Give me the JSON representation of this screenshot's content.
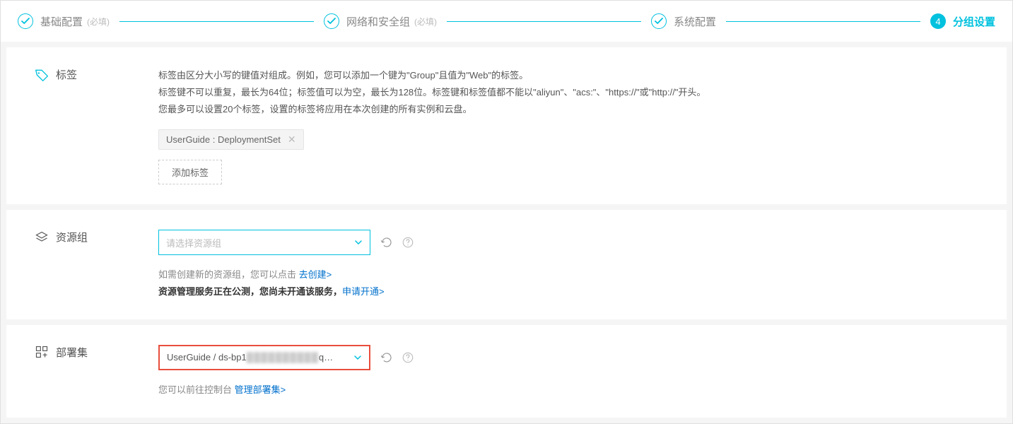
{
  "stepper": {
    "steps": [
      {
        "label": "基础配置",
        "sub": "(必填)"
      },
      {
        "label": "网络和安全组",
        "sub": "(必填)"
      },
      {
        "label": "系统配置",
        "sub": ""
      },
      {
        "label": "分组设置",
        "sub": "",
        "number": "4"
      }
    ]
  },
  "tags": {
    "title": "标签",
    "desc_line1": "标签由区分大小写的键值对组成。例如，您可以添加一个键为\"Group\"且值为\"Web\"的标签。",
    "desc_line2": "标签键不可以重复，最长为64位；标签值可以为空，最长为128位。标签键和标签值都不能以\"aliyun\"、\"acs:\"、\"https://\"或\"http://\"开头。",
    "desc_line3": "您最多可以设置20个标签，设置的标签将应用在本次创建的所有实例和云盘。",
    "chip_text": "UserGuide : DeploymentSet",
    "add_btn": "添加标签"
  },
  "resourceGroup": {
    "title": "资源组",
    "placeholder": "请选择资源组",
    "hint_prefix": "如需创建新的资源组，您可以点击 ",
    "hint_link": "去创建>",
    "line2_bold": "资源管理服务正在公测，您尚未开通该服务，",
    "line2_link": "申请开通>"
  },
  "deploymentSet": {
    "title": "部署集",
    "value_prefix": "UserGuide / ds-bp1",
    "value_blur": "██████████",
    "value_suffix": "q…",
    "hint_prefix": "您可以前往控制台 ",
    "hint_link": "管理部署集>"
  }
}
